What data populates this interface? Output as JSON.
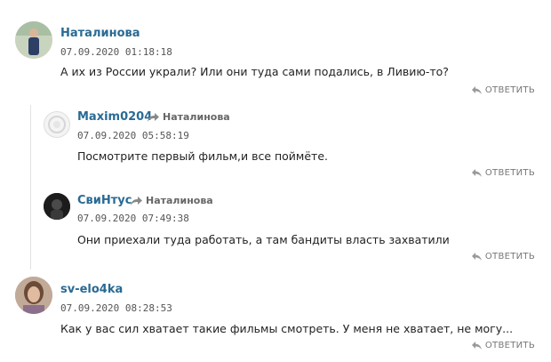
{
  "colors": {
    "author": "#2a6a94",
    "muted": "#777777"
  },
  "comments": [
    {
      "author": "Наталинова",
      "reply_to": "",
      "date": "07.09.2020 01:18:18",
      "text": "А их из России украли? Или они туда сами подались, в Ливию-то?",
      "reply_label": "ОТВЕТИТЬ"
    },
    {
      "author": "Maxim0204",
      "reply_to": "Наталинова",
      "date": "07.09.2020 05:58:19",
      "text": "Посмотрите первый фильм,и все поймёте.",
      "reply_label": "ОТВЕТИТЬ"
    },
    {
      "author": "СвиНтус",
      "reply_to": "Наталинова",
      "date": "07.09.2020 07:49:38",
      "text": "Они приехали туда работать, а там бандиты власть захватили",
      "reply_label": "ОТВЕТИТЬ"
    },
    {
      "author": "sv-elo4ka",
      "reply_to": "",
      "date": "07.09.2020 08:28:53",
      "text": "Как у вас сил хватает такие фильмы смотреть. У меня не хватает, не могу...",
      "reply_label": "ОТВЕТИТЬ"
    }
  ]
}
